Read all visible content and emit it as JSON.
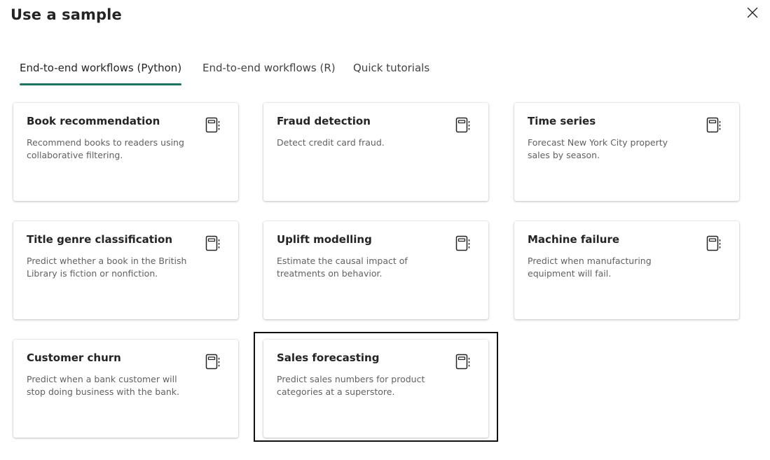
{
  "dialog": {
    "title": "Use a sample",
    "close_icon": "close-icon"
  },
  "tabs": [
    {
      "label": "End-to-end workflows (Python)",
      "active": true
    },
    {
      "label": "End-to-end workflows (R)",
      "active": false
    },
    {
      "label": "Quick tutorials",
      "active": false
    }
  ],
  "cards": [
    {
      "title": "Book recommendation",
      "description": "Recommend books to readers using collaborative filtering.",
      "icon": "notebook-icon"
    },
    {
      "title": "Fraud detection",
      "description": "Detect credit card fraud.",
      "icon": "notebook-icon"
    },
    {
      "title": "Time series",
      "description": "Forecast New York City property sales by season.",
      "icon": "notebook-icon"
    },
    {
      "title": "Title genre classification",
      "description": "Predict whether a book in the British Library is fiction or nonfiction.",
      "icon": "notebook-icon"
    },
    {
      "title": "Uplift modelling",
      "description": "Estimate the causal impact of treatments on behavior.",
      "icon": "notebook-icon"
    },
    {
      "title": "Machine failure",
      "description": "Predict when manufacturing equipment will fail.",
      "icon": "notebook-icon"
    },
    {
      "title": "Customer churn",
      "description": "Predict when a bank customer will stop doing business with the bank.",
      "icon": "notebook-icon"
    },
    {
      "title": "Sales forecasting",
      "description": "Predict sales numbers for product categories at a superstore.",
      "icon": "notebook-icon",
      "highlighted": true
    }
  ],
  "colors": {
    "accent": "#117865",
    "highlight_border": "#111111"
  }
}
